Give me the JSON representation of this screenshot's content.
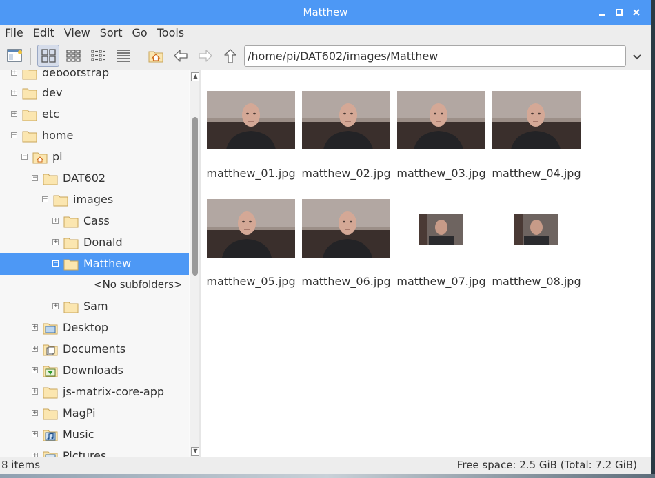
{
  "window": {
    "title": "Matthew",
    "controls": [
      "minimize",
      "maximize",
      "close"
    ]
  },
  "menu": [
    "File",
    "Edit",
    "View",
    "Sort",
    "Go",
    "Tools"
  ],
  "toolbar": {
    "path": "/home/pi/DAT602/images/Matthew",
    "buttons": [
      "new-window",
      "icon-view",
      "thumbnail-view",
      "compact-view",
      "detailed-list-view",
      "home",
      "back",
      "forward",
      "up"
    ]
  },
  "sidebar": {
    "items": [
      {
        "label": "debootstrap",
        "expander": "+",
        "icon": "folder"
      },
      {
        "label": "dev",
        "expander": "+",
        "icon": "folder"
      },
      {
        "label": "etc",
        "expander": "+",
        "icon": "folder"
      },
      {
        "label": "home",
        "expander": "−",
        "icon": "folder"
      },
      {
        "label": "pi",
        "expander": "−",
        "icon": "home-folder"
      },
      {
        "label": "DAT602",
        "expander": "−",
        "icon": "folder"
      },
      {
        "label": "images",
        "expander": "−",
        "icon": "folder"
      },
      {
        "label": "Cass",
        "expander": "+",
        "icon": "folder"
      },
      {
        "label": "Donald",
        "expander": "+",
        "icon": "folder"
      },
      {
        "label": "Matthew",
        "expander": "−",
        "icon": "folder",
        "selected": true
      },
      {
        "label": "<No subfolders>",
        "expander": "",
        "icon": ""
      },
      {
        "label": "Sam",
        "expander": "+",
        "icon": "folder"
      },
      {
        "label": "Desktop",
        "expander": "+",
        "icon": "desktop-folder"
      },
      {
        "label": "Documents",
        "expander": "+",
        "icon": "documents-folder"
      },
      {
        "label": "Downloads",
        "expander": "+",
        "icon": "downloads-folder"
      },
      {
        "label": "js-matrix-core-app",
        "expander": "+",
        "icon": "folder"
      },
      {
        "label": "MagPi",
        "expander": "+",
        "icon": "folder"
      },
      {
        "label": "Music",
        "expander": "+",
        "icon": "music-folder"
      },
      {
        "label": "Pictures",
        "expander": "+",
        "icon": "pictures-folder"
      }
    ]
  },
  "files": [
    {
      "name": "matthew_01.jpg"
    },
    {
      "name": "matthew_02.jpg"
    },
    {
      "name": "matthew_03.jpg"
    },
    {
      "name": "matthew_04.jpg"
    },
    {
      "name": "matthew_05.jpg"
    },
    {
      "name": "matthew_06.jpg"
    },
    {
      "name": "matthew_07.jpg"
    },
    {
      "name": "matthew_08.jpg"
    }
  ],
  "status": {
    "count": "8 items",
    "free_space": "Free space: 2.5 GiB (Total: 7.2 GiB)"
  },
  "colors": {
    "accent": "#4d98f5",
    "folder_fill": "#fbe6b0",
    "folder_stroke": "#c9a55a"
  }
}
